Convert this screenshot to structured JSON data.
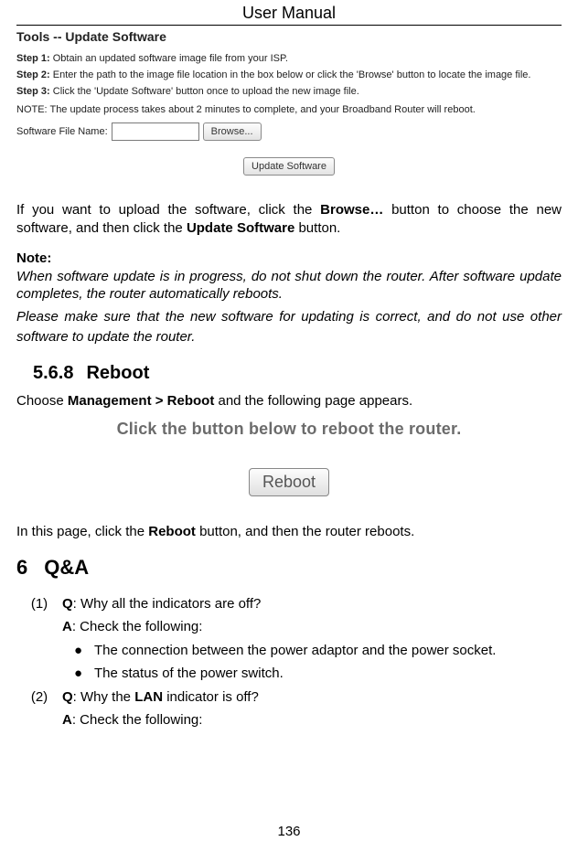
{
  "header": {
    "title": "User Manual"
  },
  "shot1": {
    "title": "Tools -- Update Software",
    "step1_label": "Step 1:",
    "step1_text": "Obtain an updated software image file from your ISP.",
    "step2_label": "Step 2:",
    "step2_text": "Enter the path to the image file location in the box below or click the 'Browse' button to locate the image file.",
    "step3_label": "Step 3:",
    "step3_text": "Click the 'Update Software' button once to upload the new image file.",
    "note": "NOTE: The update process takes about 2 minutes to complete, and your Broadband Router will reboot.",
    "file_label": "Software File Name:",
    "browse_label": "Browse...",
    "update_label": "Update Software"
  },
  "body": {
    "para1_a": "If you want to upload the software, click the ",
    "para1_b": "Browse…",
    "para1_c": " button to choose the new software, and then click the ",
    "para1_d": "Update Software",
    "para1_e": " button.",
    "note_head": "Note:",
    "note1": "When software update is in progress, do not shut down the router. After software update completes, the router automatically reboots.",
    "note2": "Please make sure that the new software for updating is correct, and do not use other software to update the router."
  },
  "section568": {
    "num": "5.6.8",
    "title": "Reboot",
    "line_a": "Choose ",
    "line_b": "Management > Reboot",
    "line_c": " and the following page appears."
  },
  "shot2": {
    "text": "Click the button below to reboot the router.",
    "button": "Reboot"
  },
  "after2_a": "In this page, click the ",
  "after2_b": "Reboot",
  "after2_c": " button, and then the router reboots.",
  "section6": {
    "num": "6",
    "title": "Q&A"
  },
  "qa": {
    "n1": "(1)",
    "q1_q": "Q",
    "q1_text": ": Why all the indicators are off?",
    "q1_a": "A",
    "q1_a_text": ": Check the following:",
    "b1": "The connection between the power adaptor and the power socket.",
    "b2": "The status of the power switch.",
    "n2": "(2)",
    "q2_q": "Q",
    "q2_text_a": ": Why the ",
    "q2_text_b": "LAN",
    "q2_text_c": " indicator is off?",
    "q2_a": "A",
    "q2_a_text": ": Check the following:"
  },
  "bullet": "●",
  "page_number": "136"
}
